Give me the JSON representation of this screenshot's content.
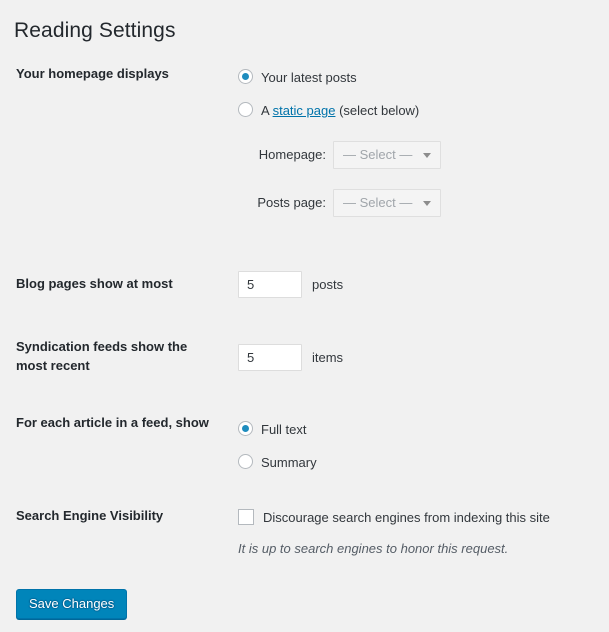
{
  "page": {
    "title": "Reading Settings"
  },
  "rows": {
    "homepage_displays": {
      "label": "Your homepage displays",
      "options": [
        {
          "label": "Your latest posts",
          "checked": true
        },
        {
          "prefix": "A ",
          "link": "static page",
          "suffix": " (select below)",
          "checked": false
        }
      ],
      "selects": [
        {
          "label": "Homepage:",
          "value": "— Select —"
        },
        {
          "label": "Posts page:",
          "value": "— Select —"
        }
      ]
    },
    "blog_pages": {
      "label": "Blog pages show at most",
      "value": "5",
      "unit": "posts"
    },
    "syndication_feeds": {
      "label": "Syndication feeds show the most recent",
      "value": "5",
      "unit": "items"
    },
    "feed_article": {
      "label": "For each article in a feed, show",
      "options": [
        {
          "label": "Full text",
          "checked": true
        },
        {
          "label": "Summary",
          "checked": false
        }
      ]
    },
    "search_visibility": {
      "label": "Search Engine Visibility",
      "checkbox_label": "Discourage search engines from indexing this site",
      "checked": false,
      "hint": "It is up to search engines to honor this request."
    }
  },
  "submit": {
    "label": "Save Changes"
  },
  "colors": {
    "accent": "#0085ba",
    "link": "#0073aa",
    "radio_dot": "#1e8cbe",
    "background": "#f1f1f1"
  }
}
